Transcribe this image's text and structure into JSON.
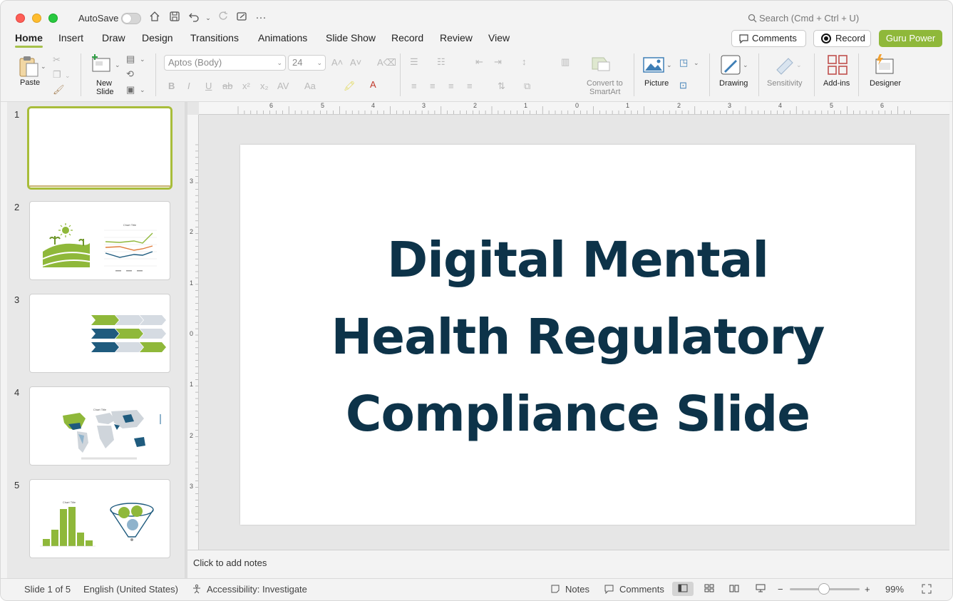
{
  "titlebar": {
    "autosave_label": "AutoSave",
    "search_placeholder": "Search (Cmd + Ctrl + U)"
  },
  "tabs": [
    {
      "label": "Home",
      "active": true
    },
    {
      "label": "Insert"
    },
    {
      "label": "Draw"
    },
    {
      "label": "Design"
    },
    {
      "label": "Transitions"
    },
    {
      "label": "Animations"
    },
    {
      "label": "Slide Show"
    },
    {
      "label": "Record"
    },
    {
      "label": "Review"
    },
    {
      "label": "View"
    }
  ],
  "actions": {
    "comments_label": "Comments",
    "record_label": "Record",
    "guru_label": "Guru Power"
  },
  "ribbon": {
    "paste_label": "Paste",
    "new_slide_label_1": "New",
    "new_slide_label_2": "Slide",
    "font_name": "Aptos (Body)",
    "font_size": "24",
    "convert_label_1": "Convert to",
    "convert_label_2": "SmartArt",
    "picture_label": "Picture",
    "drawing_label": "Drawing",
    "sensitivity_label": "Sensitivity",
    "addins_label": "Add-ins",
    "designer_label": "Designer"
  },
  "thumbnails": [
    {
      "number": "1",
      "selected": true
    },
    {
      "number": "2",
      "chart_title": "Chart Title"
    },
    {
      "number": "3"
    },
    {
      "number": "4",
      "chart_title": "Chart Title"
    },
    {
      "number": "5",
      "chart_title": "Chart Title"
    }
  ],
  "ruler": {
    "h_ticks": [
      "6",
      "5",
      "4",
      "3",
      "2",
      "1",
      "0",
      "1",
      "2",
      "3",
      "4",
      "5",
      "6"
    ],
    "v_ticks": [
      "3",
      "2",
      "1",
      "0",
      "1",
      "2",
      "3"
    ]
  },
  "slide": {
    "title_line1": "Digital Mental",
    "title_line2": "Health Regulatory",
    "title_line3": "Compliance Slide",
    "title_color": "#0d3349"
  },
  "notes": {
    "placeholder": "Click to add notes"
  },
  "status": {
    "slide_counter": "Slide 1 of 5",
    "language": "English (United States)",
    "accessibility": "Accessibility: Investigate",
    "notes_label": "Notes",
    "comments_label": "Comments",
    "zoom_level": "99%"
  },
  "colors": {
    "accent_green": "#a6c14b",
    "brand_button": "#8fb83a",
    "navy": "#0d3349",
    "teal_blue": "#1f5b7e"
  }
}
